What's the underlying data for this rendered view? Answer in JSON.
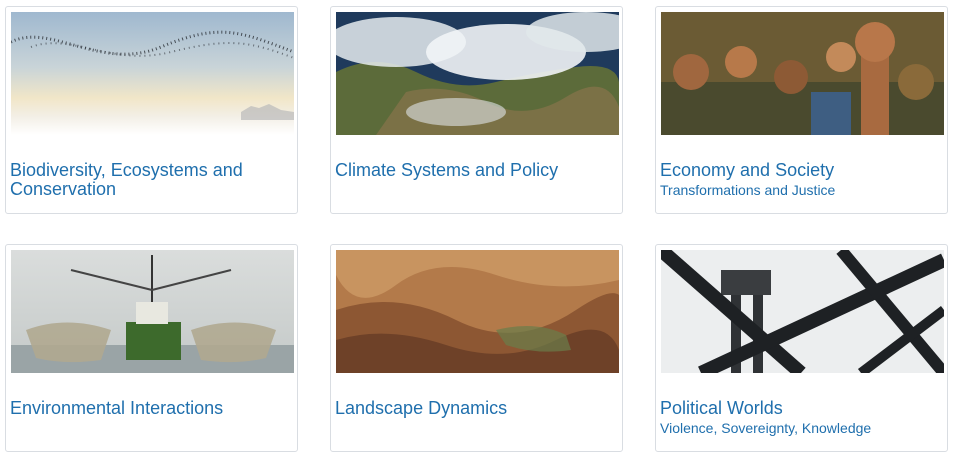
{
  "cards": [
    {
      "title": "Biodiversity, Ecosystems and Conservation",
      "subtitle": "",
      "image": "birds-sky-photo"
    },
    {
      "title": "Climate Systems and Policy",
      "subtitle": "",
      "image": "satellite-clouds-photo"
    },
    {
      "title": "Economy and Society",
      "subtitle": "Transformations and Justice",
      "image": "raised-fists-crowd-photo"
    },
    {
      "title": "Environmental Interactions",
      "subtitle": "",
      "image": "fishing-trawler-photo"
    },
    {
      "title": "Landscape Dynamics",
      "subtitle": "",
      "image": "canyon-landscape-photo"
    },
    {
      "title": "Political Worlds",
      "subtitle": "Violence, Sovereignty, Knowledge",
      "image": "watchtower-steel-photo"
    }
  ],
  "colors": {
    "link": "#1f6fad",
    "border": "#d9dde2"
  }
}
